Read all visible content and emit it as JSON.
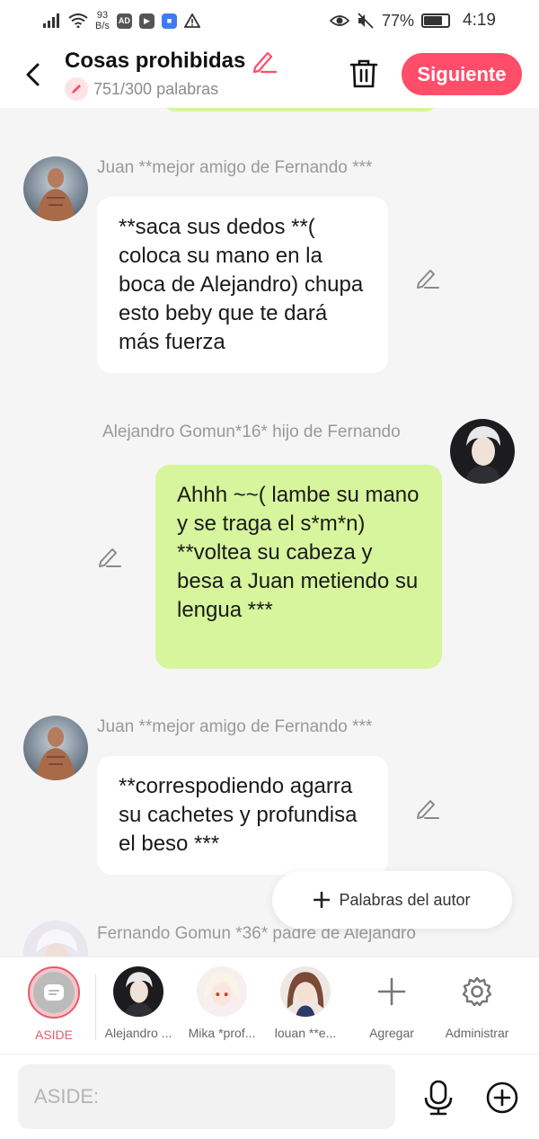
{
  "status_bar": {
    "net_speed_value": "93",
    "net_speed_unit": "B/s",
    "battery": "77%",
    "time": "4:19",
    "icons": [
      "signal-icon",
      "wifi-icon",
      "ad-icon",
      "play-icon",
      "shield-app-icon",
      "warning-icon",
      "eye-icon",
      "mute-icon",
      "battery-icon"
    ]
  },
  "header": {
    "title": "Cosas prohibidas",
    "word_count": "751/300 palabras",
    "next_label": "Siguiente",
    "accent_color": "#ff4d6a"
  },
  "messages": [
    {
      "speaker": "Juan **mejor amigo de Fernando ***",
      "side": "left",
      "text": "**saca sus dedos **( coloca su mano en la boca de Alejandro) chupa esto beby que te dará más fuerza"
    },
    {
      "speaker": "Alejandro Gomun*16* hijo de Fernando",
      "side": "right",
      "text": "Ahhh ~~( lambe su mano y se traga el s*m*n) **voltea su cabeza y besa a Juan metiendo su lengua ***"
    },
    {
      "speaker": "Juan **mejor amigo de Fernando ***",
      "side": "left",
      "text": "**correspodiendo agarra su cachetes y profundisa el beso ***"
    },
    {
      "speaker": "Fernando Gomun  *36* padre de Alejandro",
      "side": "left",
      "text": ""
    }
  ],
  "author_words_button": "Palabras del autor",
  "characters": [
    {
      "label": "ASIDE",
      "selected": true
    },
    {
      "label": "Alejandro ..."
    },
    {
      "label": "Mika *prof..."
    },
    {
      "label": "louan **e..."
    },
    {
      "label": "Agregar"
    },
    {
      "label": "Administrar"
    }
  ],
  "input": {
    "placeholder": "ASIDE:"
  },
  "colors": {
    "bubble_green": "#d6f59c",
    "bubble_white": "#ffffff",
    "background": "#f5f5f5"
  }
}
